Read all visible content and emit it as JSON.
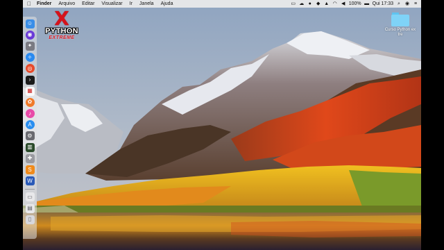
{
  "menubar": {
    "apple_icon": "apple-icon",
    "app_name": "Finder",
    "menus": [
      "Arquivo",
      "Editar",
      "Visualizar",
      "Ir",
      "Janela",
      "Ajuda"
    ],
    "status": {
      "battery_text": "100%",
      "clock": "Qui 17:33"
    }
  },
  "logo": {
    "mark": "X",
    "line1": "PYTHON",
    "line2": "EXTREME"
  },
  "desktop": {
    "folder_label_line1": "Curso Python ex",
    "folder_label_line2": "tre"
  },
  "dock": {
    "apps": [
      "finder-icon",
      "siri-icon",
      "launchpad-icon",
      "safari-icon",
      "chrome-icon",
      "terminal-icon",
      "calendar-icon",
      "photos-icon",
      "itunes-icon",
      "app-store-icon",
      "system-preferences-icon",
      "activity-monitor-icon",
      "automator-icon",
      "sublime-text-icon",
      "word-icon",
      "downloads-stack-icon",
      "documents-stack-icon",
      "trash-icon"
    ]
  },
  "colors": {
    "logo_red": "#d6121b",
    "folder_blue": "#7fd3f7"
  }
}
